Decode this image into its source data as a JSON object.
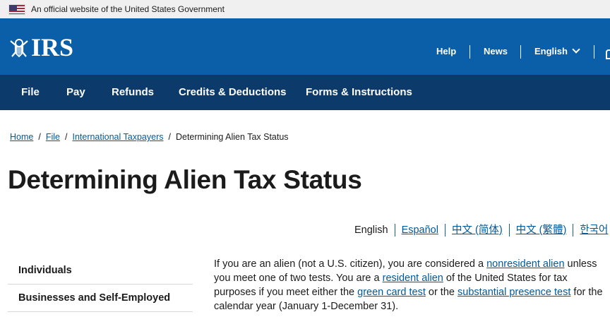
{
  "gov_banner": {
    "text": "An official website of the United States Government",
    "flag_icon": "us-flag-icon"
  },
  "header": {
    "logo_text": "IRS",
    "logo_icon": "irs-eagle-icon",
    "utility": {
      "help": "Help",
      "news": "News",
      "language": "English"
    }
  },
  "nav": {
    "items": [
      "File",
      "Pay",
      "Refunds",
      "Credits & Deductions",
      "Forms & Instructions"
    ]
  },
  "breadcrumb": {
    "items": [
      "Home",
      "File",
      "International Taxpayers"
    ],
    "current": "Determining Alien Tax Status"
  },
  "page": {
    "title": "Determining Alien Tax Status"
  },
  "languages": [
    "English",
    "Español",
    "中文 (简体)",
    "中文 (繁體)",
    "한국어"
  ],
  "sidenav": {
    "items": [
      "Individuals",
      "Businesses and Self-Employed"
    ]
  },
  "content": {
    "p1": {
      "t1": "If you are an alien (not a U.S. citizen), you are considered a ",
      "l1": "nonresident alien",
      "t2": " unless you meet one of two tests. You are a ",
      "l2": "resident alien",
      "t3": " of the United States for tax purposes if you meet either the ",
      "l3": "green card test",
      "t4": " or the ",
      "l4": "substantial presence test",
      "t5": " for the calendar year (January 1-December 31)."
    }
  },
  "colors": {
    "header_bg": "#0b5ea8",
    "nav_bg": "#0c3b6b",
    "link": "#00599c",
    "banner_bg": "#f0f0f0"
  }
}
